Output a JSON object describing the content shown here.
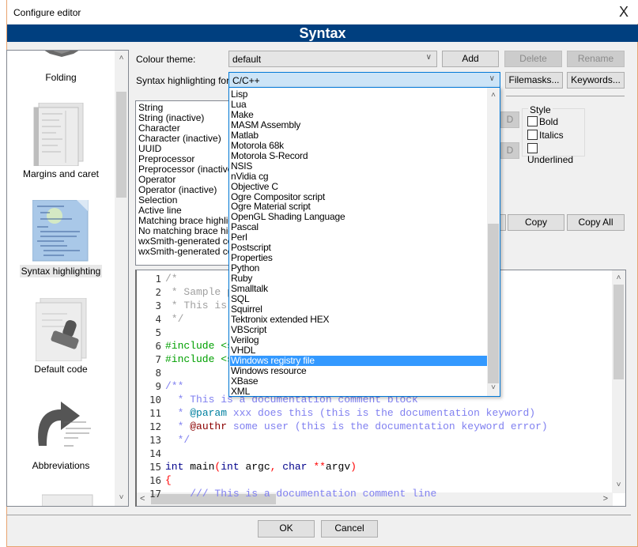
{
  "window": {
    "title": "Configure editor",
    "close_label": "X"
  },
  "banner": {
    "title": "Syntax"
  },
  "sidebar": {
    "items": [
      {
        "label": "Folding",
        "icon": "folding-icon"
      },
      {
        "label": "Margins and caret",
        "icon": "margins-caret-icon"
      },
      {
        "label": "Syntax highlighting",
        "icon": "syntax-highlighting-icon",
        "selected": true
      },
      {
        "label": "Default code",
        "icon": "default-code-icon"
      },
      {
        "label": "Abbreviations",
        "icon": "abbreviations-icon"
      }
    ],
    "scroll_up": "˄",
    "scroll_down": "˅"
  },
  "colour_theme": {
    "label": "Colour theme:",
    "value": "default",
    "add_label": "Add",
    "delete_label": "Delete",
    "rename_label": "Rename"
  },
  "syntax_for": {
    "label": "Syntax highlighting for:",
    "value": "C/C++",
    "filemasks_label": "Filemasks...",
    "keywords_label": "Keywords..."
  },
  "attributes": [
    "String",
    "String (inactive)",
    "Character",
    "Character (inactive)",
    "UUID",
    "Preprocessor",
    "Preprocessor (inactive)",
    "Operator",
    "Operator (inactive)",
    "Selection",
    "Active line",
    "Matching brace highlight",
    "No matching brace highlight",
    "wxSmith-generated code",
    "wxSmith-generated code"
  ],
  "colour_buttons": {
    "fg_label": "D",
    "bg_label": "D"
  },
  "style": {
    "legend": "Style",
    "bold_label": "Bold",
    "italics_label": "Italics",
    "underlined_label": "Underlined",
    "bold": false,
    "italics": false,
    "underlined": false
  },
  "copy_buttons": {
    "copy_label": "Copy",
    "copy_all_label": "Copy All"
  },
  "dropdown": {
    "options": [
      "Lisp",
      "Lua",
      "Make",
      "MASM Assembly",
      "Matlab",
      "Motorola 68k",
      "Motorola S-Record",
      "NSIS",
      "nVidia cg",
      "Objective C",
      "Ogre Compositor script",
      "Ogre Material script",
      "OpenGL Shading Language",
      "Pascal",
      "Perl",
      "Postscript",
      "Properties",
      "Python",
      "Ruby",
      "Smalltalk",
      "SQL",
      "Squirrel",
      "Tektronix extended HEX",
      "VBScript",
      "Verilog",
      "VHDL",
      "Windows registry file",
      "Windows resource",
      "XBase",
      "XML"
    ],
    "highlighted": "Windows registry file"
  },
  "code_sample": {
    "lines": [
      {
        "n": "1",
        "parts": [
          [
            "c-com",
            "/*"
          ]
        ]
      },
      {
        "n": "2",
        "parts": [
          [
            "c-com",
            " * Sample preview code"
          ]
        ]
      },
      {
        "n": "3",
        "parts": [
          [
            "c-com",
            " * This is a block comment"
          ]
        ]
      },
      {
        "n": "4",
        "parts": [
          [
            "c-com",
            " */"
          ]
        ]
      },
      {
        "n": "5",
        "parts": []
      },
      {
        "n": "6",
        "parts": [
          [
            "c-pre",
            "#include <stdio.h>"
          ]
        ]
      },
      {
        "n": "7",
        "parts": [
          [
            "c-pre",
            "#include <stdlib.h>"
          ]
        ]
      },
      {
        "n": "8",
        "parts": []
      },
      {
        "n": "9",
        "parts": [
          [
            "c-doc",
            "/**"
          ]
        ]
      },
      {
        "n": "10",
        "parts": [
          [
            "c-doc",
            "  * This is a documentation comment block"
          ]
        ]
      },
      {
        "n": "11",
        "parts": [
          [
            "c-doc",
            "  * "
          ],
          [
            "c-dockw",
            "@param"
          ],
          [
            "c-doc",
            " xxx does this (this is the documentation keyword)"
          ]
        ]
      },
      {
        "n": "12",
        "parts": [
          [
            "c-doc",
            "  * "
          ],
          [
            "c-docerr",
            "@authr"
          ],
          [
            "c-doc",
            " some user (this is the documentation keyword error)"
          ]
        ]
      },
      {
        "n": "13",
        "parts": [
          [
            "c-doc",
            "  */"
          ]
        ]
      },
      {
        "n": "14",
        "parts": []
      },
      {
        "n": "15",
        "parts": [
          [
            "c-kw",
            "int"
          ],
          [
            "c-id",
            " main"
          ],
          [
            "c-op",
            "("
          ],
          [
            "c-kw",
            "int"
          ],
          [
            "c-id",
            " argc"
          ],
          [
            "c-op",
            ","
          ],
          [
            "c-id",
            " "
          ],
          [
            "c-kw",
            "char"
          ],
          [
            "c-id",
            " "
          ],
          [
            "c-op",
            "**"
          ],
          [
            "c-id",
            "argv"
          ],
          [
            "c-op",
            ")"
          ]
        ]
      },
      {
        "n": "16",
        "parts": [
          [
            "c-op",
            "{"
          ]
        ]
      },
      {
        "n": "17",
        "parts": [
          [
            "c-doc",
            "    /// This is a documentation comment line"
          ]
        ]
      }
    ]
  },
  "footer": {
    "ok_label": "OK",
    "cancel_label": "Cancel"
  }
}
